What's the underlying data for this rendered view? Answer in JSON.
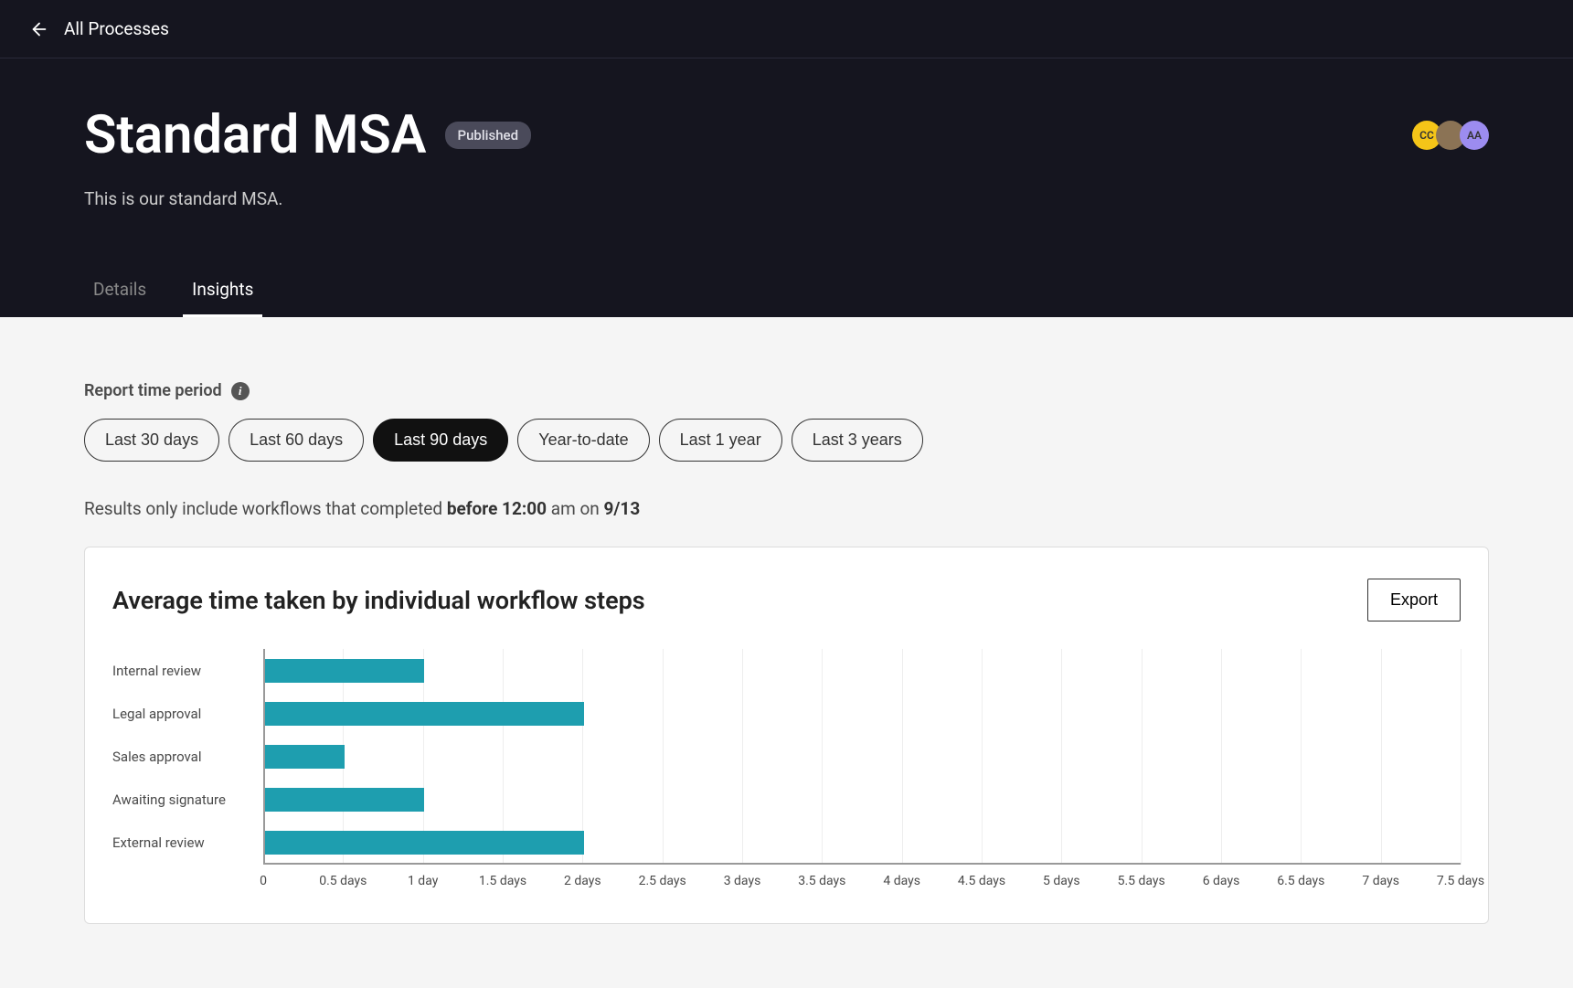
{
  "nav": {
    "back_label": "All Processes"
  },
  "header": {
    "title": "Standard MSA",
    "status": "Published",
    "subtitle": "This is our standard MSA.",
    "avatars": [
      {
        "initials": "CC",
        "bg": "#f5c518",
        "fg": "#333"
      },
      {
        "initials": "",
        "bg": "#8b7355",
        "fg": "#fff"
      },
      {
        "initials": "AA",
        "bg": "#9c8cf0",
        "fg": "#333"
      }
    ]
  },
  "tabs": [
    {
      "label": "Details",
      "active": false
    },
    {
      "label": "Insights",
      "active": true
    }
  ],
  "filter": {
    "label": "Report time period",
    "options": [
      {
        "label": "Last 30 days",
        "active": false
      },
      {
        "label": "Last 60 days",
        "active": false
      },
      {
        "label": "Last 90 days",
        "active": true
      },
      {
        "label": "Year-to-date",
        "active": false
      },
      {
        "label": "Last 1 year",
        "active": false
      },
      {
        "label": "Last 3 years",
        "active": false
      }
    ]
  },
  "results_note": {
    "prefix": "Results only include workflows that completed ",
    "bold1": "before 12:00",
    "mid": " am on ",
    "bold2": "9/13"
  },
  "card": {
    "title": "Average time taken by individual workflow steps",
    "export_label": "Export"
  },
  "chart_data": {
    "type": "bar",
    "orientation": "horizontal",
    "title": "Average time taken by individual workflow steps",
    "xlabel": "",
    "ylabel": "",
    "xlim": [
      0,
      7.5
    ],
    "x_ticks": [
      0,
      0.5,
      1,
      1.5,
      2,
      2.5,
      3,
      3.5,
      4,
      4.5,
      5,
      5.5,
      6,
      6.5,
      7,
      7.5
    ],
    "x_tick_labels": [
      "0",
      "0.5 days",
      "1 day",
      "1.5 days",
      "2 days",
      "2.5 days",
      "3 days",
      "3.5 days",
      "4 days",
      "4.5 days",
      "5 days",
      "5.5 days",
      "6 days",
      "6.5 days",
      "7 days",
      "7.5 days"
    ],
    "categories": [
      "Internal review",
      "Legal approval",
      "Sales approval",
      "Awaiting signature",
      "External review"
    ],
    "values": [
      1.0,
      2.0,
      0.5,
      1.0,
      2.0
    ],
    "bar_color": "#1e9eaf"
  }
}
